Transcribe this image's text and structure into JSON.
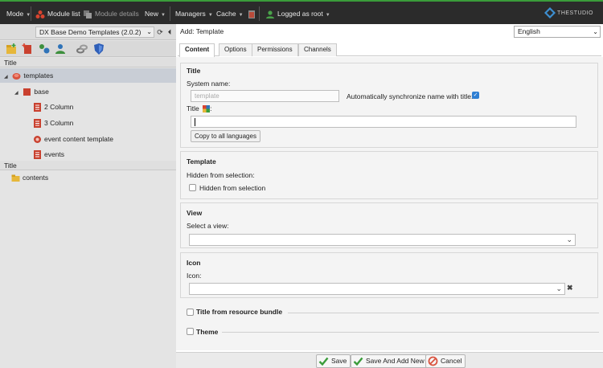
{
  "topbar": {
    "mode": "Mode",
    "module_list": "Module list",
    "module_details": "Module details",
    "new": "New",
    "managers": "Managers",
    "cache": "Cache",
    "logged_as": "Logged as root",
    "logo_text": "THESTUDIO"
  },
  "left": {
    "site_select": "DX Base Demo Templates (2.0.2)",
    "tree_header": "Title",
    "nodes": [
      {
        "label": "templates"
      },
      {
        "label": "base"
      },
      {
        "label": "2 Column"
      },
      {
        "label": "3 Column"
      },
      {
        "label": "event content template"
      },
      {
        "label": "events"
      }
    ],
    "tree_header2": "Title",
    "content_node": "contents"
  },
  "form": {
    "title": "Add: Template",
    "language": "English",
    "tabs": [
      "Content",
      "Options",
      "Permissions",
      "Channels"
    ],
    "title_section": {
      "legend": "Title",
      "system_name_label": "System name:",
      "system_name_value": "template",
      "sync_label": "Automatically synchronize name with title:",
      "title_label": "Title",
      "title_label_colon": ":",
      "copy_button": "Copy to all languages"
    },
    "template_section": {
      "legend": "Template",
      "hidden_label": "Hidden from selection:",
      "hidden_checkbox_label": "Hidden from selection"
    },
    "view_section": {
      "legend": "View",
      "select_label": "Select a view:"
    },
    "icon_section": {
      "legend": "Icon",
      "icon_label": "Icon:"
    },
    "collapsed": {
      "resource_bundle": "Title from resource bundle",
      "theme": "Theme"
    },
    "footer": {
      "save": "Save",
      "save_add_new": "Save And Add New",
      "cancel": "Cancel"
    }
  },
  "colors": {
    "topbar_bg": "#2b2b2b",
    "accent_green": "#3a9c3a",
    "checkbox_blue": "#2f7fd3"
  }
}
